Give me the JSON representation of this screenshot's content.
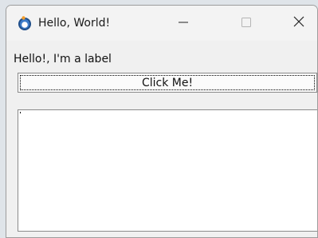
{
  "window": {
    "title": "Hello, World!",
    "icon": "python-app-icon",
    "controls": [
      "minimize-icon",
      "maximize-icon",
      "close-icon"
    ]
  },
  "content": {
    "label": "Hello!, I'm a label",
    "button_label": "Click Me!",
    "text_area_value": ""
  },
  "colors": {
    "window_bg": "#f0f0f0",
    "titlebar_bg": "#f3f3f3",
    "text_area_bg": "#ffffff",
    "border": "#8a8a8a"
  }
}
